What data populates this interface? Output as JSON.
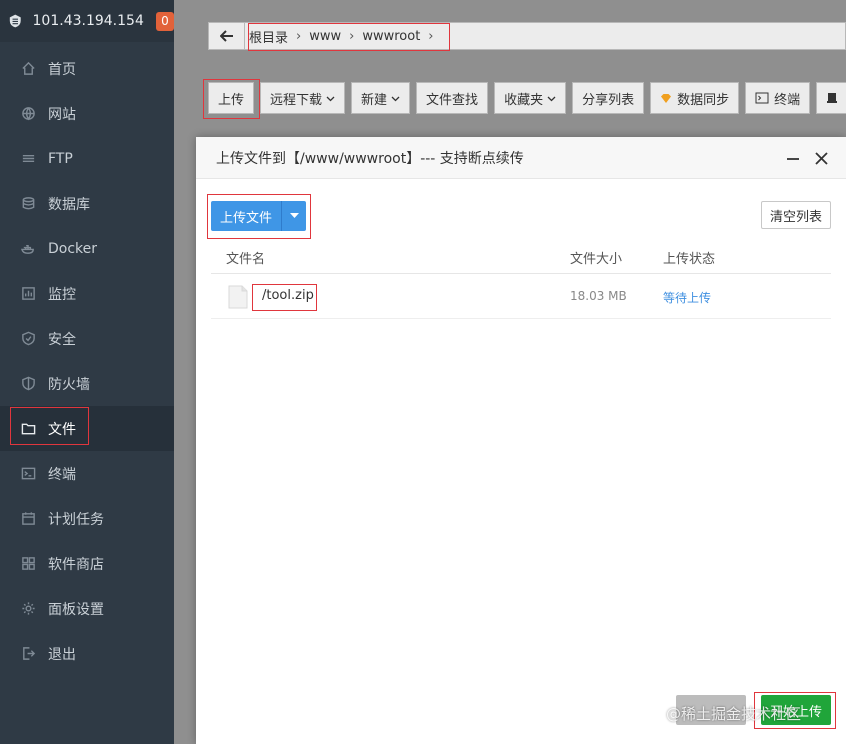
{
  "sidebar": {
    "server_ip": "101.43.194.154",
    "badge_count": "0",
    "items": [
      {
        "label": "首页",
        "icon": "home-icon"
      },
      {
        "label": "网站",
        "icon": "globe-icon"
      },
      {
        "label": "FTP",
        "icon": "ftp-icon"
      },
      {
        "label": "数据库",
        "icon": "database-icon"
      },
      {
        "label": "Docker",
        "icon": "docker-icon"
      },
      {
        "label": "监控",
        "icon": "monitor-icon"
      },
      {
        "label": "安全",
        "icon": "shield-icon"
      },
      {
        "label": "防火墙",
        "icon": "firewall-icon"
      },
      {
        "label": "文件",
        "icon": "folder-icon"
      },
      {
        "label": "终端",
        "icon": "terminal-icon"
      },
      {
        "label": "计划任务",
        "icon": "calendar-icon"
      },
      {
        "label": "软件商店",
        "icon": "apps-icon"
      },
      {
        "label": "面板设置",
        "icon": "gear-icon"
      },
      {
        "label": "退出",
        "icon": "logout-icon"
      }
    ],
    "active_index": 8
  },
  "breadcrumb": {
    "items": [
      "根目录",
      "www",
      "wwwroot"
    ]
  },
  "toolbar": {
    "upload": "上传",
    "remote_download": "远程下载",
    "new": "新建",
    "file_search": "文件查找",
    "favorites": "收藏夹",
    "share_list": "分享列表",
    "data_sync": "数据同步",
    "terminal": "终端"
  },
  "dialog": {
    "title": "上传文件到【/www/wwwroot】--- 支持断点续传",
    "upload_file_button": "上传文件",
    "clear_list_button": "清空列表",
    "columns": {
      "name": "文件名",
      "size": "文件大小",
      "status": "上传状态"
    },
    "files": [
      {
        "name": "/tool.zip",
        "size": "18.03 MB",
        "status": "等待上传"
      }
    ],
    "start_upload_button": "开始上传",
    "watermark": "@稀土掘金技术社区"
  },
  "colors": {
    "sidebar_bg": "#2f3a45",
    "primary_blue": "#3f96e6",
    "start_green": "#20a53a",
    "highlight_red": "#e0363d",
    "badge_orange": "#e2623a"
  }
}
